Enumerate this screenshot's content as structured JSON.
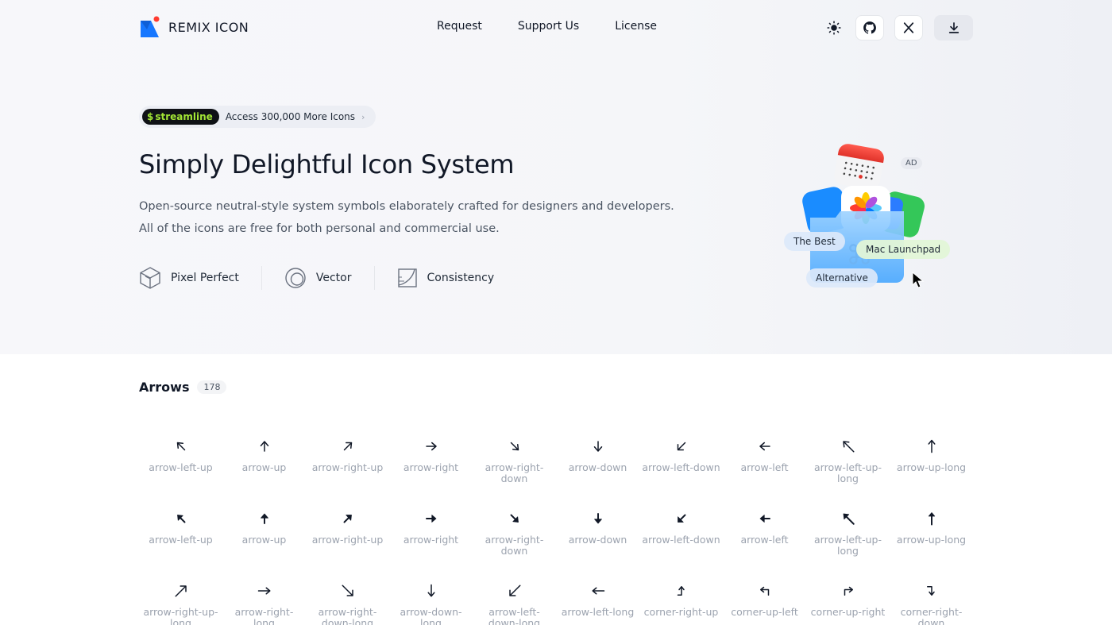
{
  "header": {
    "brand": "REMIX ICON",
    "nav": [
      "Request",
      "Support Us",
      "License"
    ]
  },
  "promo": {
    "badge": "streamline",
    "text": "Access 300,000 More Icons"
  },
  "hero": {
    "title": "Simply Delightful Icon System",
    "desc_line1": "Open-source neutral-style system symbols elaborately crafted for designers and developers.",
    "desc_line2": "All of the icons are free for both personal and commercial use.",
    "features": [
      "Pixel Perfect",
      "Vector",
      "Consistency"
    ]
  },
  "ad": {
    "badge": "AD",
    "pill_best": "The Best",
    "pill_launchpad": "Mac Launchpad",
    "pill_alt": "Alternative"
  },
  "section": {
    "name": "Arrows",
    "count": "178"
  },
  "rows": [
    [
      "arrow-left-up",
      "arrow-up",
      "arrow-right-up",
      "arrow-right",
      "arrow-right-down",
      "arrow-down",
      "arrow-left-down",
      "arrow-left",
      "arrow-left-up-long",
      "arrow-up-long"
    ],
    [
      "arrow-left-up",
      "arrow-up",
      "arrow-right-up",
      "arrow-right",
      "arrow-right-down",
      "arrow-down",
      "arrow-left-down",
      "arrow-left",
      "arrow-left-up-long",
      "arrow-up-long"
    ],
    [
      "arrow-right-up-long",
      "arrow-right-long",
      "arrow-right-down-long",
      "arrow-down-long",
      "arrow-left-down-long",
      "arrow-left-long",
      "corner-right-up",
      "corner-up-left",
      "corner-up-right",
      "corner-right-down"
    ]
  ],
  "row_styles": [
    "line",
    "fill",
    "line"
  ],
  "colors": {
    "brand_blue": "#1677ff",
    "brand_red": "#ff3b30",
    "streamline_green": "#a3e635",
    "text_dark": "#111827",
    "label_gray": "#9ca3af"
  }
}
